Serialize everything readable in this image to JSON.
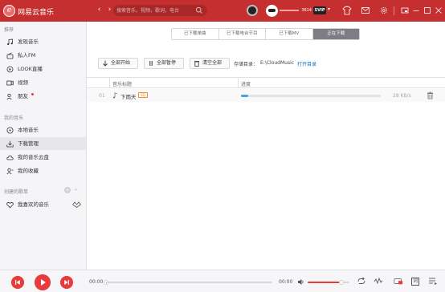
{
  "app": {
    "title": "网易云音乐"
  },
  "search": {
    "placeholder": "搜索音乐，视频，歌词，电台"
  },
  "user": {
    "name": "3614",
    "vip_label": "SVIP"
  },
  "sidebar": {
    "section_recommend": "推荐",
    "recommend_items": [
      "发现音乐",
      "私人FM",
      "LOOK直播",
      "视频",
      "朋友"
    ],
    "section_my_music": "我的音乐",
    "my_music_items": [
      "本地音乐",
      "下载管理",
      "我的音乐云盘",
      "我的收藏"
    ],
    "section_playlists": "创建的歌单",
    "playlist_items": [
      "我喜欢的音乐"
    ]
  },
  "tabs": [
    "已下载单曲",
    "已下载电台节目",
    "已下载MV",
    "正在下载"
  ],
  "actions": {
    "start_all": "全部开始",
    "pause_all": "全部暂停",
    "clear_all": "清空全部"
  },
  "storage": {
    "label": "存储目录：",
    "path": "E:\\CloudMusic",
    "open_dir": "打开目录"
  },
  "table": {
    "col_title": "音乐标题",
    "col_progress": "进度",
    "rows": [
      {
        "index": "01",
        "title": "下雨天",
        "badge": "SQ",
        "progress": 0.05,
        "speed": "28 KB/s"
      }
    ]
  },
  "player": {
    "current_time": "00:00",
    "total_time": "00:00",
    "progress": 0.0,
    "volume": 0.8,
    "lyrics_label": "词"
  },
  "colors": {
    "brand": "#c62f2f",
    "accent": "#e83c3c",
    "progress": "#4d9fde"
  }
}
